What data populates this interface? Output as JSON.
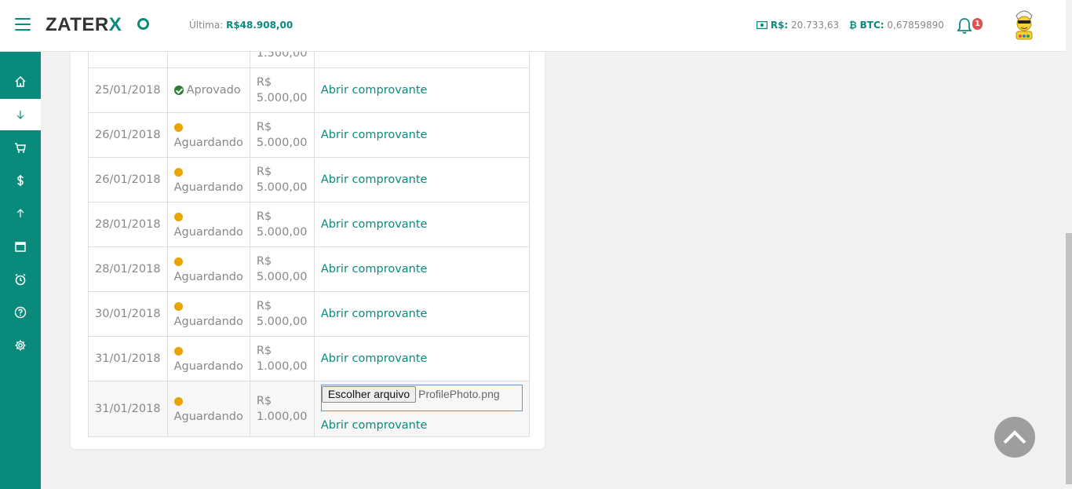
{
  "header": {
    "logo_text": "ZATER",
    "logo_x": "X",
    "last_label": "Última:",
    "last_value": "R$48.908,00",
    "brl_label": "R$:",
    "brl_value": "20.733,63",
    "btc_label": "BTC:",
    "btc_value": "0,67859890",
    "notifications": "1"
  },
  "sidebar": {
    "items": [
      {
        "name": "home",
        "icon": "home-icon"
      },
      {
        "name": "deposit",
        "icon": "arrow-down-icon",
        "active": true
      },
      {
        "name": "cart",
        "icon": "cart-icon"
      },
      {
        "name": "money",
        "icon": "dollar-icon"
      },
      {
        "name": "withdraw",
        "icon": "arrow-up-icon"
      },
      {
        "name": "calendar",
        "icon": "calendar-icon"
      },
      {
        "name": "alarm",
        "icon": "alarm-icon"
      },
      {
        "name": "help",
        "icon": "help-icon"
      },
      {
        "name": "settings",
        "icon": "gear-icon"
      }
    ]
  },
  "table": {
    "partial_row": {
      "amount_tail": "1.500,00"
    },
    "rows": [
      {
        "date": "25/01/2018",
        "status": "Aprovado",
        "currency": "R$",
        "amount": "5.000,00",
        "link": "Abrir comprovante"
      },
      {
        "date": "26/01/2018",
        "status": "Aguardando",
        "currency": "R$",
        "amount": "5.000,00",
        "link": "Abrir comprovante"
      },
      {
        "date": "26/01/2018",
        "status": "Aguardando",
        "currency": "R$",
        "amount": "5.000,00",
        "link": "Abrir comprovante"
      },
      {
        "date": "28/01/2018",
        "status": "Aguardando",
        "currency": "R$",
        "amount": "5.000,00",
        "link": "Abrir comprovante"
      },
      {
        "date": "28/01/2018",
        "status": "Aguardando",
        "currency": "R$",
        "amount": "5.000,00",
        "link": "Abrir comprovante"
      },
      {
        "date": "30/01/2018",
        "status": "Aguardando",
        "currency": "R$",
        "amount": "5.000,00",
        "link": "Abrir comprovante"
      },
      {
        "date": "31/01/2018",
        "status": "Aguardando",
        "currency": "R$",
        "amount": "1.000,00",
        "link": "Abrir comprovante"
      },
      {
        "date": "31/01/2018",
        "status": "Aguardando",
        "currency": "R$",
        "amount": "1.000,00",
        "link": "Abrir comprovante",
        "file_button": "Escolher arquivo",
        "file_name": "ProfilePhoto.png"
      }
    ]
  },
  "colors": {
    "accent": "#0a8a7b",
    "approved": "#2e7d32",
    "pending": "#e8a400",
    "badge": "#e05252"
  }
}
